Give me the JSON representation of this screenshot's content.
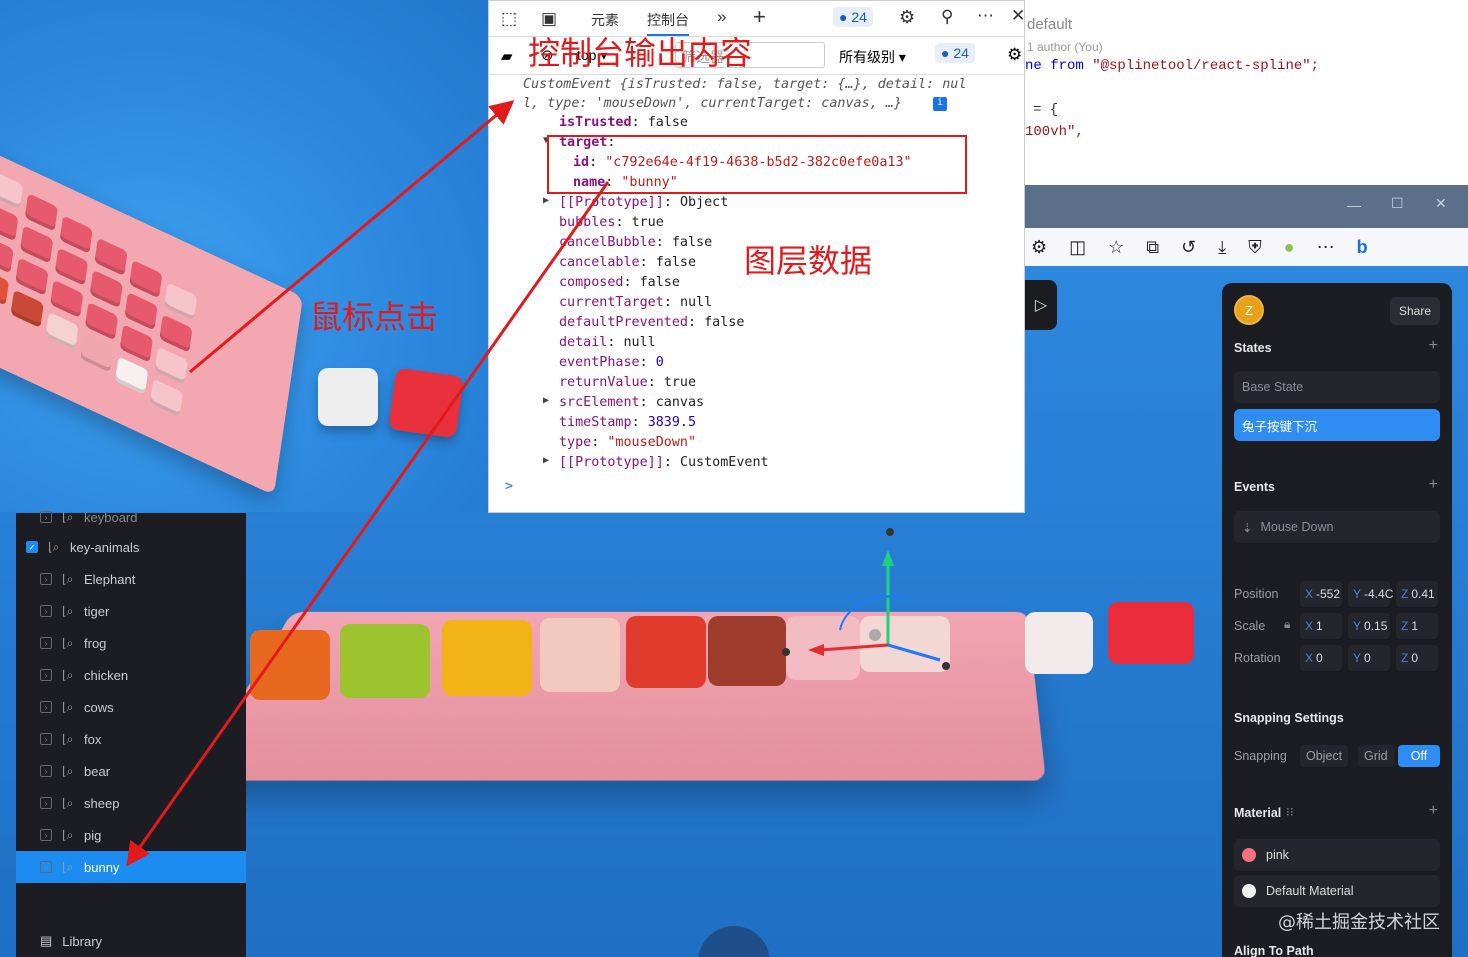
{
  "devtools": {
    "tabs": [
      "元素",
      "控制台"
    ],
    "issues_count": "24",
    "context_selector": "top",
    "filter_placeholder": "筛选器",
    "level_selector": "所有级别",
    "issues_count2": "24"
  },
  "console": {
    "summary_line1": "CustomEvent {isTrusted: false, target: {…}, detail: nul",
    "summary_line2": "l, type: 'mouseDown', currentTarget: canvas, …}",
    "lines": [
      {
        "key": "isTrusted",
        "sep": ": ",
        "val": "false"
      },
      {
        "key": "target",
        "sep": ":",
        "val": ""
      },
      {
        "key": "id",
        "sep": ": ",
        "val": "\"c792e64e-4f19-4638-b5d2-382c0efe0a13\""
      },
      {
        "key": "name",
        "sep": ": ",
        "val": "\"bunny\""
      },
      {
        "key": "[[Prototype]]",
        "sep": ": ",
        "val": "Object"
      },
      {
        "key": "bubbles",
        "sep": ": ",
        "val": "true"
      },
      {
        "key": "cancelBubble",
        "sep": ": ",
        "val": "false"
      },
      {
        "key": "cancelable",
        "sep": ": ",
        "val": "false"
      },
      {
        "key": "composed",
        "sep": ": ",
        "val": "false"
      },
      {
        "key": "currentTarget",
        "sep": ": ",
        "val": "null"
      },
      {
        "key": "defaultPrevented",
        "sep": ": ",
        "val": "false"
      },
      {
        "key": "detail",
        "sep": ": ",
        "val": "null"
      },
      {
        "key": "eventPhase",
        "sep": ": ",
        "val": "0"
      },
      {
        "key": "returnValue",
        "sep": ": ",
        "val": "true"
      },
      {
        "key": "srcElement",
        "sep": ": ",
        "val": "canvas"
      },
      {
        "key": "timeStamp",
        "sep": ": ",
        "val": "3839.5"
      },
      {
        "key": "type",
        "sep": ": ",
        "val": "\"mouseDown\""
      },
      {
        "key": "[[Prototype]]",
        "sep": ": ",
        "val": "CustomEvent"
      }
    ],
    "prompt": ">"
  },
  "annotations": {
    "console_output": "控制台输出内容",
    "layer_data": "图层数据",
    "mouse_click": "鼠标点击"
  },
  "code": {
    "line1": "default",
    "line2": "1 author (You)",
    "line3_kw": "ne from ",
    "line3_str": "\"@splinetool/react-spline\";",
    "line4": "= {",
    "line5": "100vh\","
  },
  "layers": {
    "partial_top": "keyboard",
    "items": [
      "key-animals",
      "Elephant",
      "tiger",
      "frog",
      "chicken",
      "cows",
      "fox",
      "bear",
      "sheep",
      "pig",
      "bunny"
    ],
    "selected": "bunny",
    "library": "Library"
  },
  "right_panel": {
    "avatar_letter": "Z",
    "share": "Share",
    "states_title": "States",
    "base_state": "Base State",
    "active_state": "兔子按键下沉",
    "events_title": "Events",
    "event_item": "Mouse Down",
    "position_label": "Position",
    "position": {
      "x": "-552",
      "y": "-4.4C",
      "z": "0.41"
    },
    "scale_label": "Scale",
    "scale": {
      "x": "1",
      "y": "0.15",
      "z": "1"
    },
    "rotation_label": "Rotation",
    "rotation": {
      "x": "0",
      "y": "0",
      "z": "0"
    },
    "snapping_title": "Snapping Settings",
    "snapping_label": "Snapping",
    "snap_object": "Object",
    "snap_grid": "Grid",
    "snap_off": "Off",
    "material_title": "Material",
    "materials": [
      "pink",
      "Default Material"
    ],
    "align_to_path": "Align To Path"
  },
  "watermark": "@稀土掘金技术社区",
  "colors": {
    "accent": "#1d8cf0",
    "callout": "#e31a1c",
    "active_state": "#2e8cf3"
  }
}
